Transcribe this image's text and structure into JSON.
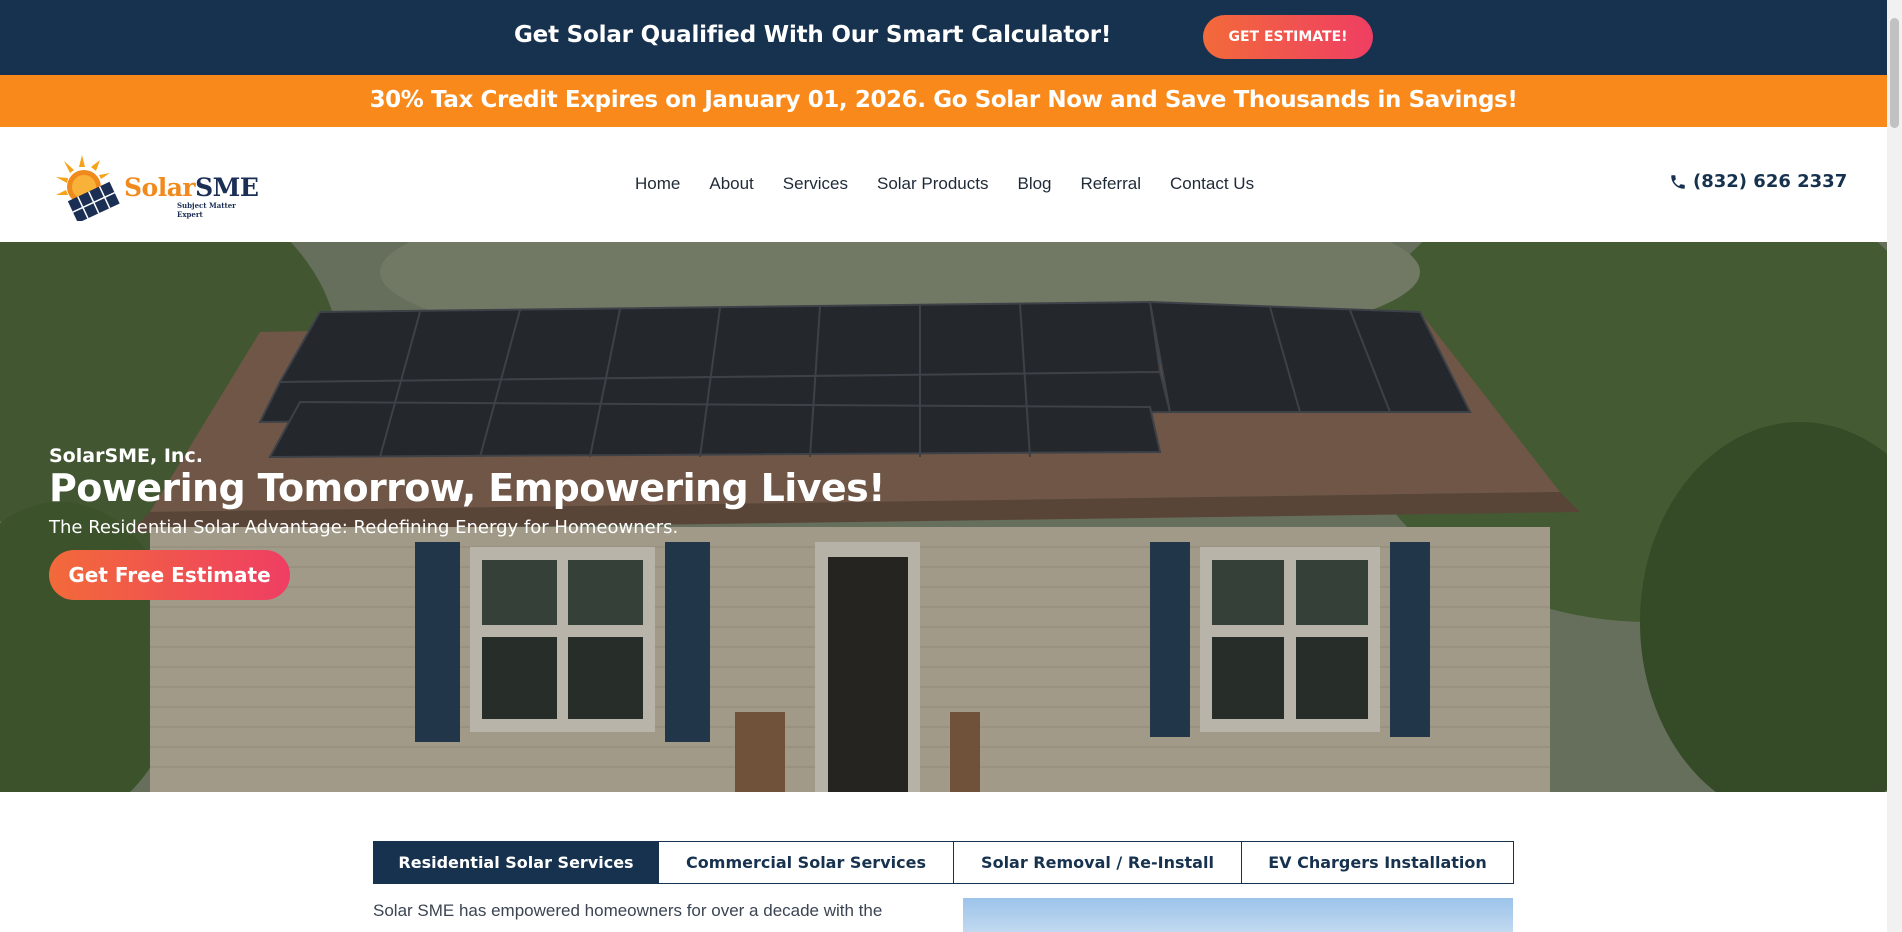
{
  "topbar": {
    "headline": "Get Solar Qualified With Our Smart Calculator!",
    "button_label": "GET ESTIMATE!"
  },
  "taxbar": {
    "text": "30% Tax Credit Expires on January 01, 2026. Go Solar Now and Save Thousands in Savings!"
  },
  "header": {
    "logo": {
      "name_part1": "Solar",
      "name_part2": "SME",
      "tagline": "Subject Matter Expert"
    },
    "nav": [
      "Home",
      "About",
      "Services",
      "Solar Products",
      "Blog",
      "Referral",
      "Contact Us"
    ],
    "phone": "(832) 626 2337"
  },
  "hero": {
    "company": "SolarSME, Inc.",
    "title": "Powering Tomorrow, Empowering Lives!",
    "subtitle": "The Residential Solar Advantage: Redefining Energy for Homeowners.",
    "button_label": "Get Free Estimate"
  },
  "tabs": [
    {
      "label": "Residential Solar Services",
      "active": true
    },
    {
      "label": "Commercial Solar Services",
      "active": false
    },
    {
      "label": "Solar Removal / Re-Install",
      "active": false
    },
    {
      "label": "EV Chargers Installation",
      "active": false
    }
  ],
  "intro": {
    "text": "Solar SME has empowered homeowners for over a decade with the"
  },
  "colors": {
    "navy": "#17324f",
    "orange": "#f8891a",
    "cta_gradient_start": "#f26a3a",
    "cta_gradient_end": "#ef3e63"
  }
}
